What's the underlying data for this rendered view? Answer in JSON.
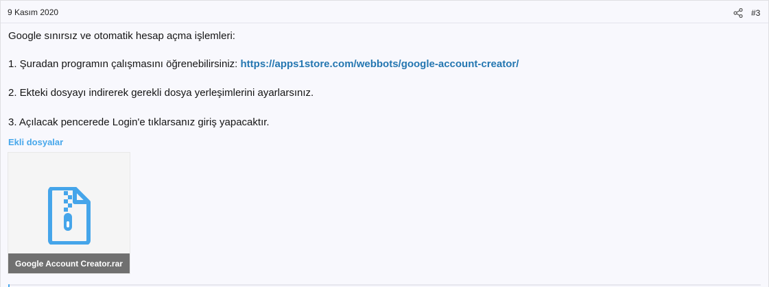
{
  "post": {
    "date": "9 Kasım 2020",
    "number": "#3",
    "share_icon": "share-icon",
    "intro": "Google sınırsız ve otomatik hesap açma işlemleri:",
    "step1_text": "1. Şuradan programın çalışmasını öğrenebilirsiniz: ",
    "step1_link": "https://apps1store.com/webbots/google-account-creator/",
    "step2": "2. Ekteki dosyayı indirerek gerekli dosya yerleşimlerini ayarlarsınız.",
    "step3": "3. Açılacak pencerede Login'e tıklarsanız giriş yapacaktır."
  },
  "attachments": {
    "title": "Ekli dosyalar",
    "items": [
      {
        "name": "Google Account Creator.rar",
        "icon": "zip-file-icon"
      }
    ]
  },
  "colors": {
    "link": "#2577b1",
    "accent": "#47a7eb",
    "background": "#f8f8fd"
  }
}
